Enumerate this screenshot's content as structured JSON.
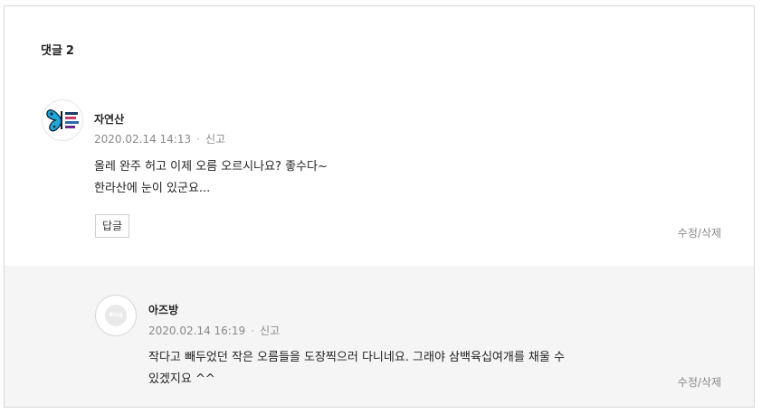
{
  "comments_header": {
    "label": "댓글",
    "count": "2"
  },
  "comments": [
    {
      "author": "자연산",
      "date": "2020.02.14 14:13",
      "separator": "·",
      "report_label": "신고",
      "lines": [
        "올레 완주 허고 이제 오름 오르시나요? 좋수다~",
        "한라산에 눈이 있군요..."
      ],
      "reply_button": "답글",
      "edit_delete": "수정/삭제",
      "avatar_icon": "butterfly-icon"
    }
  ],
  "replies": [
    {
      "author": "아즈방",
      "date": "2020.02.14 16:19",
      "separator": "·",
      "report_label": "신고",
      "lines": [
        "작다고 빼두었던 작은 오름들을 도장찍으러 다니네요. 그래야 삼백육십여개를 채울 수",
        "있겠지요 ^^"
      ],
      "edit_delete": "수정/삭제",
      "avatar_icon": "blog-default-icon",
      "avatar_text": "Blog"
    }
  ]
}
